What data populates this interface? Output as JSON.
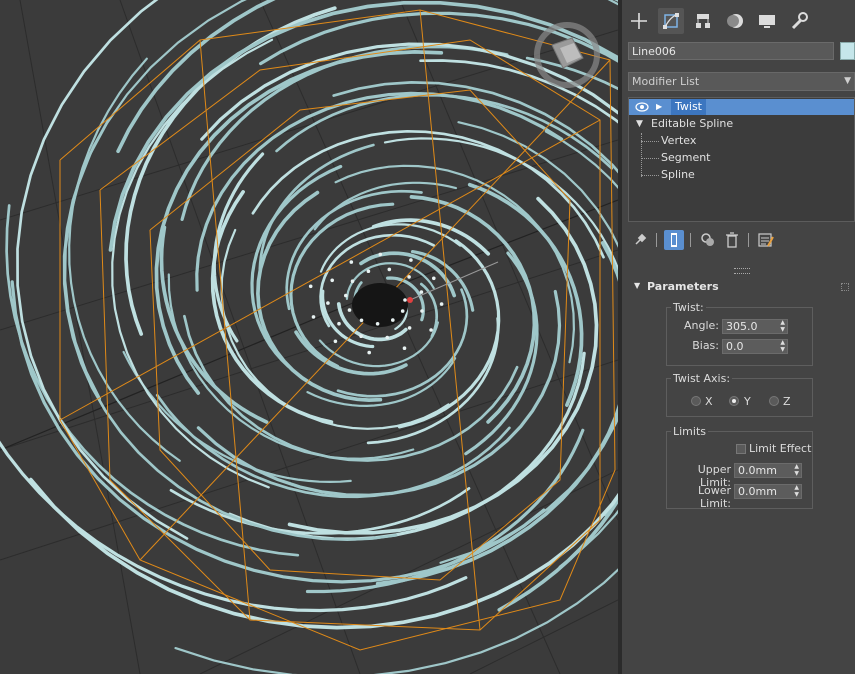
{
  "viewport": {
    "description_icons": [
      "viewcube-icon"
    ]
  },
  "command_panel": {
    "tabs": [
      {
        "icon": "create-icon",
        "active": false
      },
      {
        "icon": "modify-icon",
        "active": true
      },
      {
        "icon": "hierarchy-icon",
        "active": false
      },
      {
        "icon": "motion-icon",
        "active": false
      },
      {
        "icon": "display-icon",
        "active": false
      },
      {
        "icon": "utilities-icon",
        "active": false
      }
    ],
    "object_name": "Line006",
    "object_color": "#c5e6ea",
    "modifier_list_label": "Modifier List",
    "stack": {
      "twist": "Twist",
      "editable_spline": "Editable Spline",
      "vertex": "Vertex",
      "segment": "Segment",
      "spline": "Spline"
    },
    "parameters": {
      "title": "Parameters",
      "twist_group": "Twist:",
      "angle_label": "Angle:",
      "angle_value": "305.0",
      "bias_label": "Bias:",
      "bias_value": "0.0",
      "twist_axis_group": "Twist Axis:",
      "axis_x": "X",
      "axis_y": "Y",
      "axis_z": "Z",
      "selected_axis": "Y",
      "limits_group": "Limits",
      "limit_effect_label": "Limit Effect",
      "limit_effect_checked": false,
      "upper_limit_label": "Upper Limit:",
      "upper_limit_value": "0.0mm",
      "lower_limit_label": "Lower Limit:",
      "lower_limit_value": "0.0mm"
    },
    "accent_color": "#5a8fd0"
  }
}
